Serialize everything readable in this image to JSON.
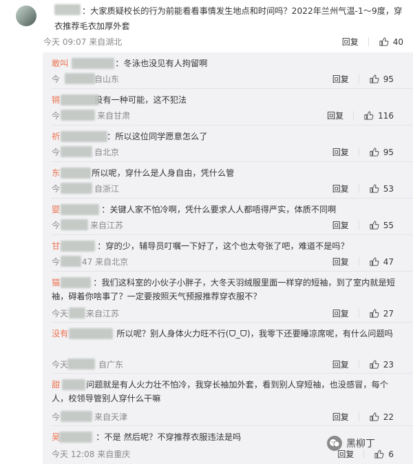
{
  "top_comment": {
    "username": "",
    "text": "：大家质疑校长的行为前能看看事情发生地点和时间吗？2022年兰州气温-1～9度，穿衣推荐毛衣加厚外套",
    "time": "今天 09:07",
    "location": "来自湖北",
    "reply_label": "回复",
    "like_count": "40"
  },
  "replies": [
    {
      "name": "敢叫",
      "text": "：冬泳也没见有人拘留啊",
      "time": "今",
      "location": "自山东",
      "reply_label": "回复",
      "like_count": "95"
    },
    {
      "name": "锵",
      "text": "没有一种可能，这不犯法",
      "time": "今",
      "location": "来自甘肃",
      "reply_label": "回复",
      "like_count": "116"
    },
    {
      "name": "祈",
      "text": "：所以这位同学愿意怎么了",
      "time": "今",
      "location": "自北京",
      "reply_label": "回复",
      "like_count": "95"
    },
    {
      "name": "东",
      "text": "所以呢，穿什么是人身自由，凭什么管",
      "time": "今",
      "location": "自浙江",
      "reply_label": "回复",
      "like_count": "53"
    },
    {
      "name": "婴",
      "text": "：关键人家不怕冷啊，凭什么要求人人都唔得严实，体质不同啊",
      "time": "今",
      "location": "来自江苏",
      "reply_label": "回复",
      "like_count": "55"
    },
    {
      "name": "甘",
      "text": "：穿的少，辅导员叮嘱一下好了，这个也太夸张了吧，难道不是吗？",
      "time": "今",
      "extra": "47",
      "location": "来自北京",
      "reply_label": "回复",
      "like_count": "47"
    },
    {
      "name": "猫",
      "text": "：我们这科室的小伙子小胖子，大冬天羽绒服里面一样穿的短袖，到了室内就是短袖，碍着你啥事了？一定要按照天气预报推荐穿衣服不？",
      "time": "今天",
      "location": "来自江苏",
      "reply_label": "回复",
      "like_count": "27"
    },
    {
      "name": "没有",
      "text": "所以呢？别人身体火力旺不行(ᗜ_ᗜ)，我零下还要睡凉席呢，有什么问题吗",
      "time": "今天",
      "location": "自广东",
      "reply_label": "回复",
      "like_count": "23"
    },
    {
      "name": "甜",
      "text": "问题就是有人火力壮不怕冷，我穿长袖加外套，看到别人穿短袖，也没感冒，每个人，校领导管别人穿什么干嘛",
      "time": "今",
      "location": "来自天津",
      "reply_label": "回复",
      "like_count": "22"
    },
    {
      "name": "吴",
      "text": "：不是 然后呢？不穿推荐衣服违法是吗",
      "time": "今天 12:08",
      "location": "来自重庆",
      "reply_label": "回复",
      "like_count": "6"
    }
  ],
  "watermark": {
    "text": "黑柳丁"
  },
  "colors": {
    "name": "#eb7350",
    "meta": "#888888",
    "panel": "#f2f2f5"
  },
  "icons": {
    "like": "thumbs-up-icon",
    "watermark": "wechat-logo-icon"
  }
}
